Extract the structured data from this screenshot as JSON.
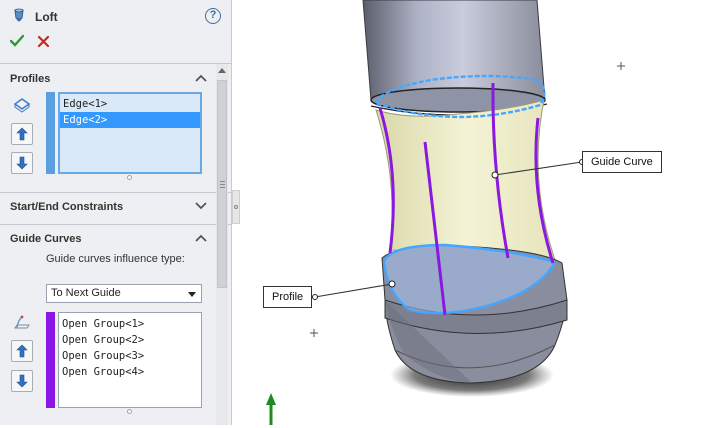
{
  "property_manager": {
    "title": "Loft",
    "help_symbol": "?",
    "ok_icon": "green-check-icon",
    "cancel_icon": "red-x-icon"
  },
  "profiles": {
    "title": "Profiles",
    "items": [
      "Edge<1>",
      "Edge<2>"
    ],
    "selected_index": 1,
    "bar_color": "#5aa0e0"
  },
  "start_end_constraints": {
    "title": "Start/End Constraints"
  },
  "guide_curves": {
    "title": "Guide Curves",
    "influence_label": "Guide curves influence type:",
    "influence_value": "To Next Guide",
    "items": [
      "Open Group<1>",
      "Open Group<2>",
      "Open Group<3>",
      "Open Group<4>"
    ],
    "bar_color": "#8b16e6"
  },
  "graphics": {
    "callout_guide_curve": "Guide Curve",
    "callout_profile": "Profile",
    "guide_color": "#8a18e0",
    "profile_color": "#46a6ff"
  }
}
